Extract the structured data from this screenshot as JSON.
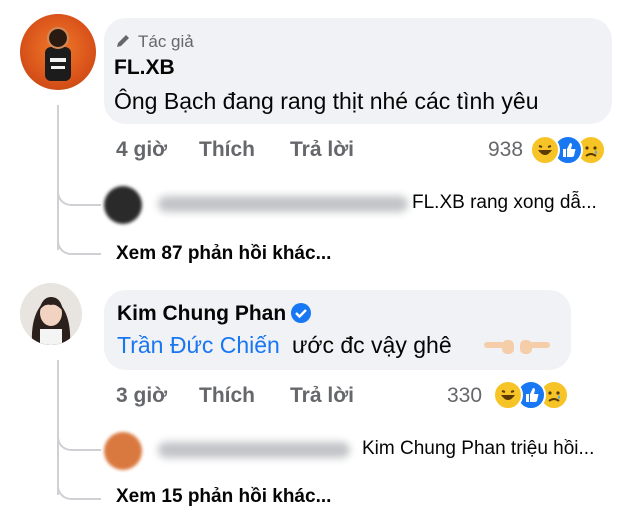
{
  "comments": [
    {
      "author_badge": "Tác giả",
      "author": "FL.XB",
      "text": "Ông Bạch đang rang thịt nhé các tình yêu",
      "time": "4 giờ",
      "like_label": "Thích",
      "reply_label": "Trả lời",
      "reaction_count": "938",
      "reactions": [
        "haha-icon",
        "like-icon",
        "sad-icon"
      ],
      "reply_preview": "FL.XB rang xong dẫ...",
      "more_replies": "Xem 87 phản hồi khác..."
    },
    {
      "author": "Kim Chung Phan",
      "mention": "Trần Đức Chiến",
      "text": "ước đc vậy ghê",
      "time": "3 giờ",
      "like_label": "Thích",
      "reply_label": "Trả lời",
      "reaction_count": "330",
      "reactions": [
        "haha-icon",
        "like-icon",
        "sad-icon"
      ],
      "reply_preview": "Kim Chung Phan triệu hồi...",
      "more_replies": "Xem 15 phản hồi khác..."
    }
  ],
  "colors": {
    "link": "#1876f2",
    "bubble": "#f0f2f5",
    "meta": "#65676b",
    "verified": "#1877f2"
  }
}
